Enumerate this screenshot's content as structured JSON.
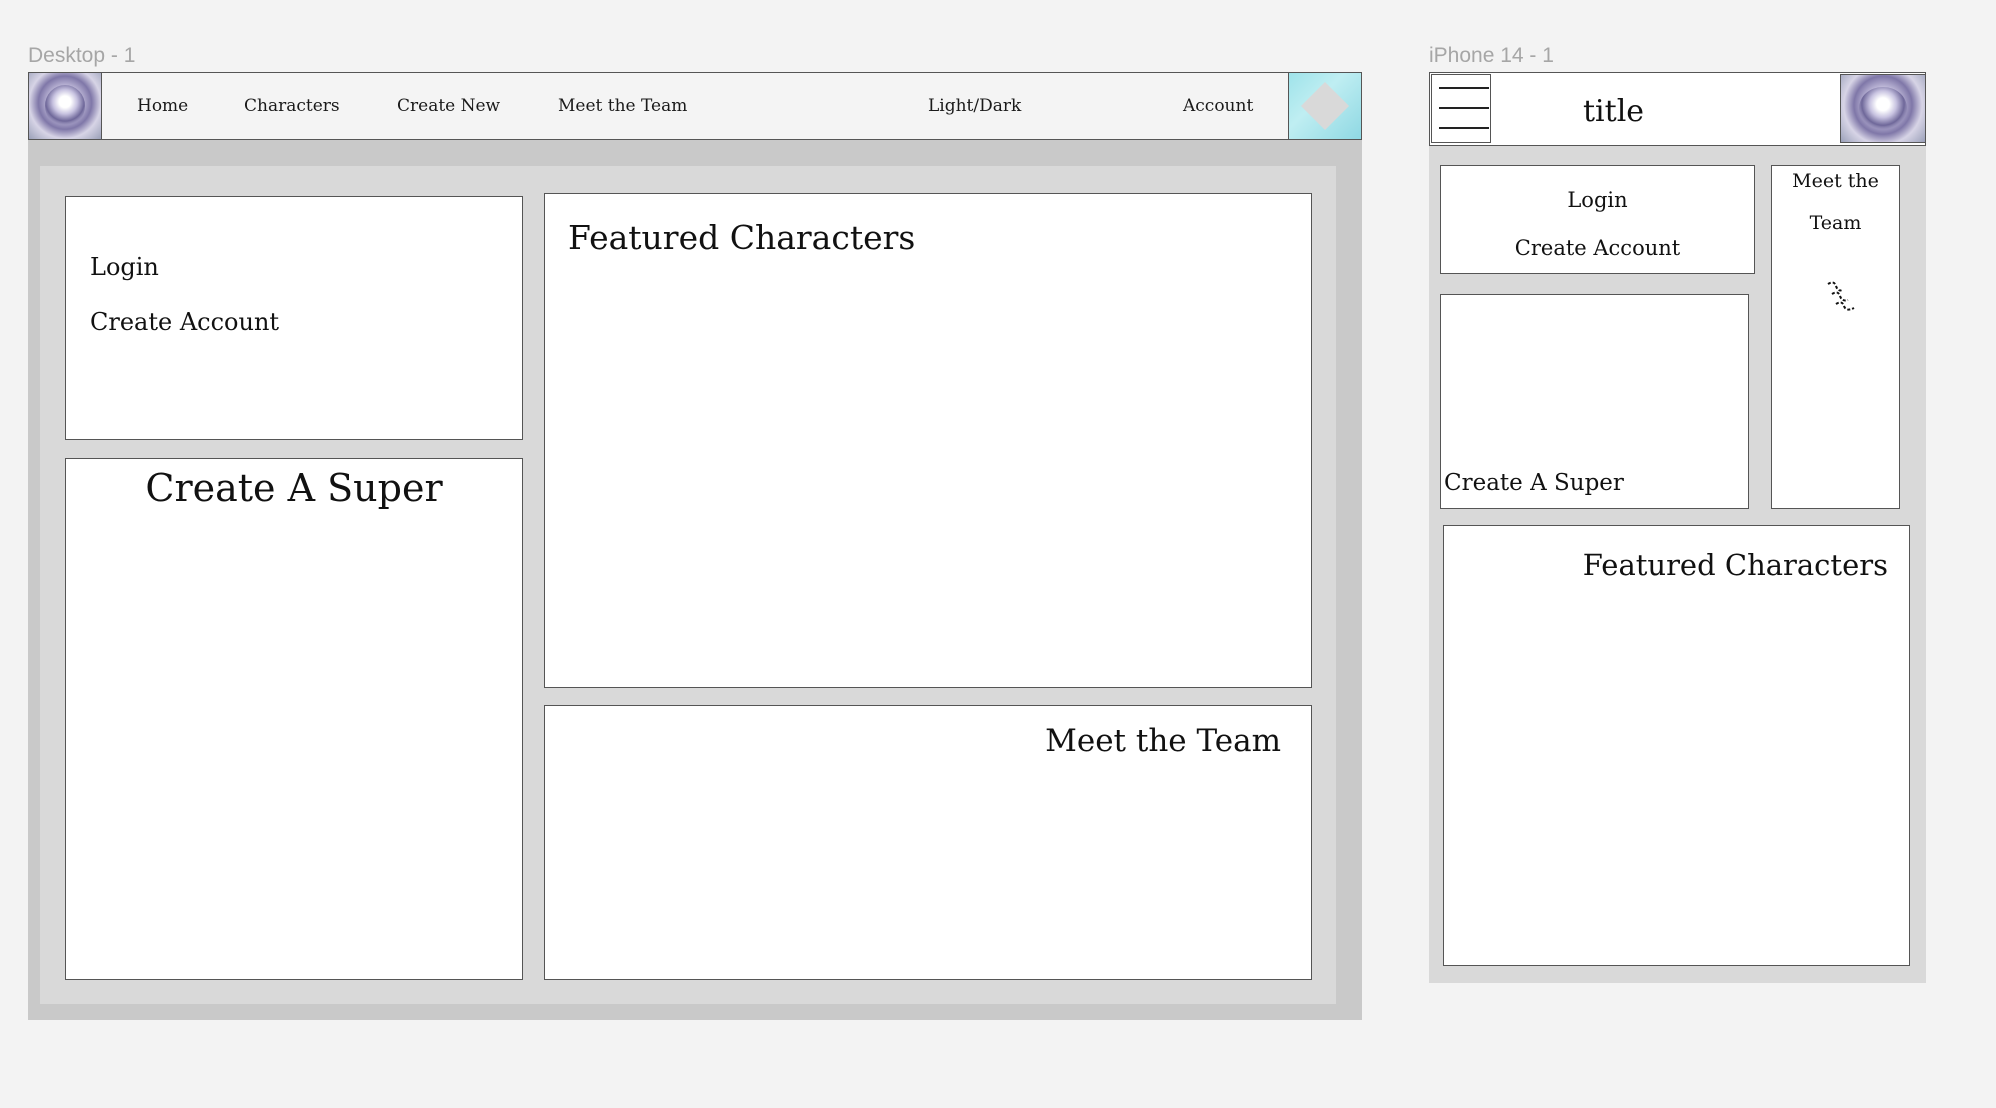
{
  "desktop": {
    "frame_label": "Desktop - 1",
    "nav": {
      "items": [
        "Home",
        "Characters",
        "Create New",
        "Meet the Team",
        "Light/Dark",
        "Account"
      ]
    },
    "auth": {
      "login": "Login",
      "create_account": "Create Account"
    },
    "create_super_title": "Create A Super",
    "featured_title": "Featured Characters",
    "team_title": "Meet the Team"
  },
  "phone": {
    "frame_label": "iPhone 14 - 1",
    "title": "title",
    "auth": {
      "login": "Login",
      "create_account": "Create Account"
    },
    "team_line1": "Meet the",
    "team_line2": "Team",
    "create_super_title": "Create A Super",
    "featured_title": "Featured Characters"
  }
}
